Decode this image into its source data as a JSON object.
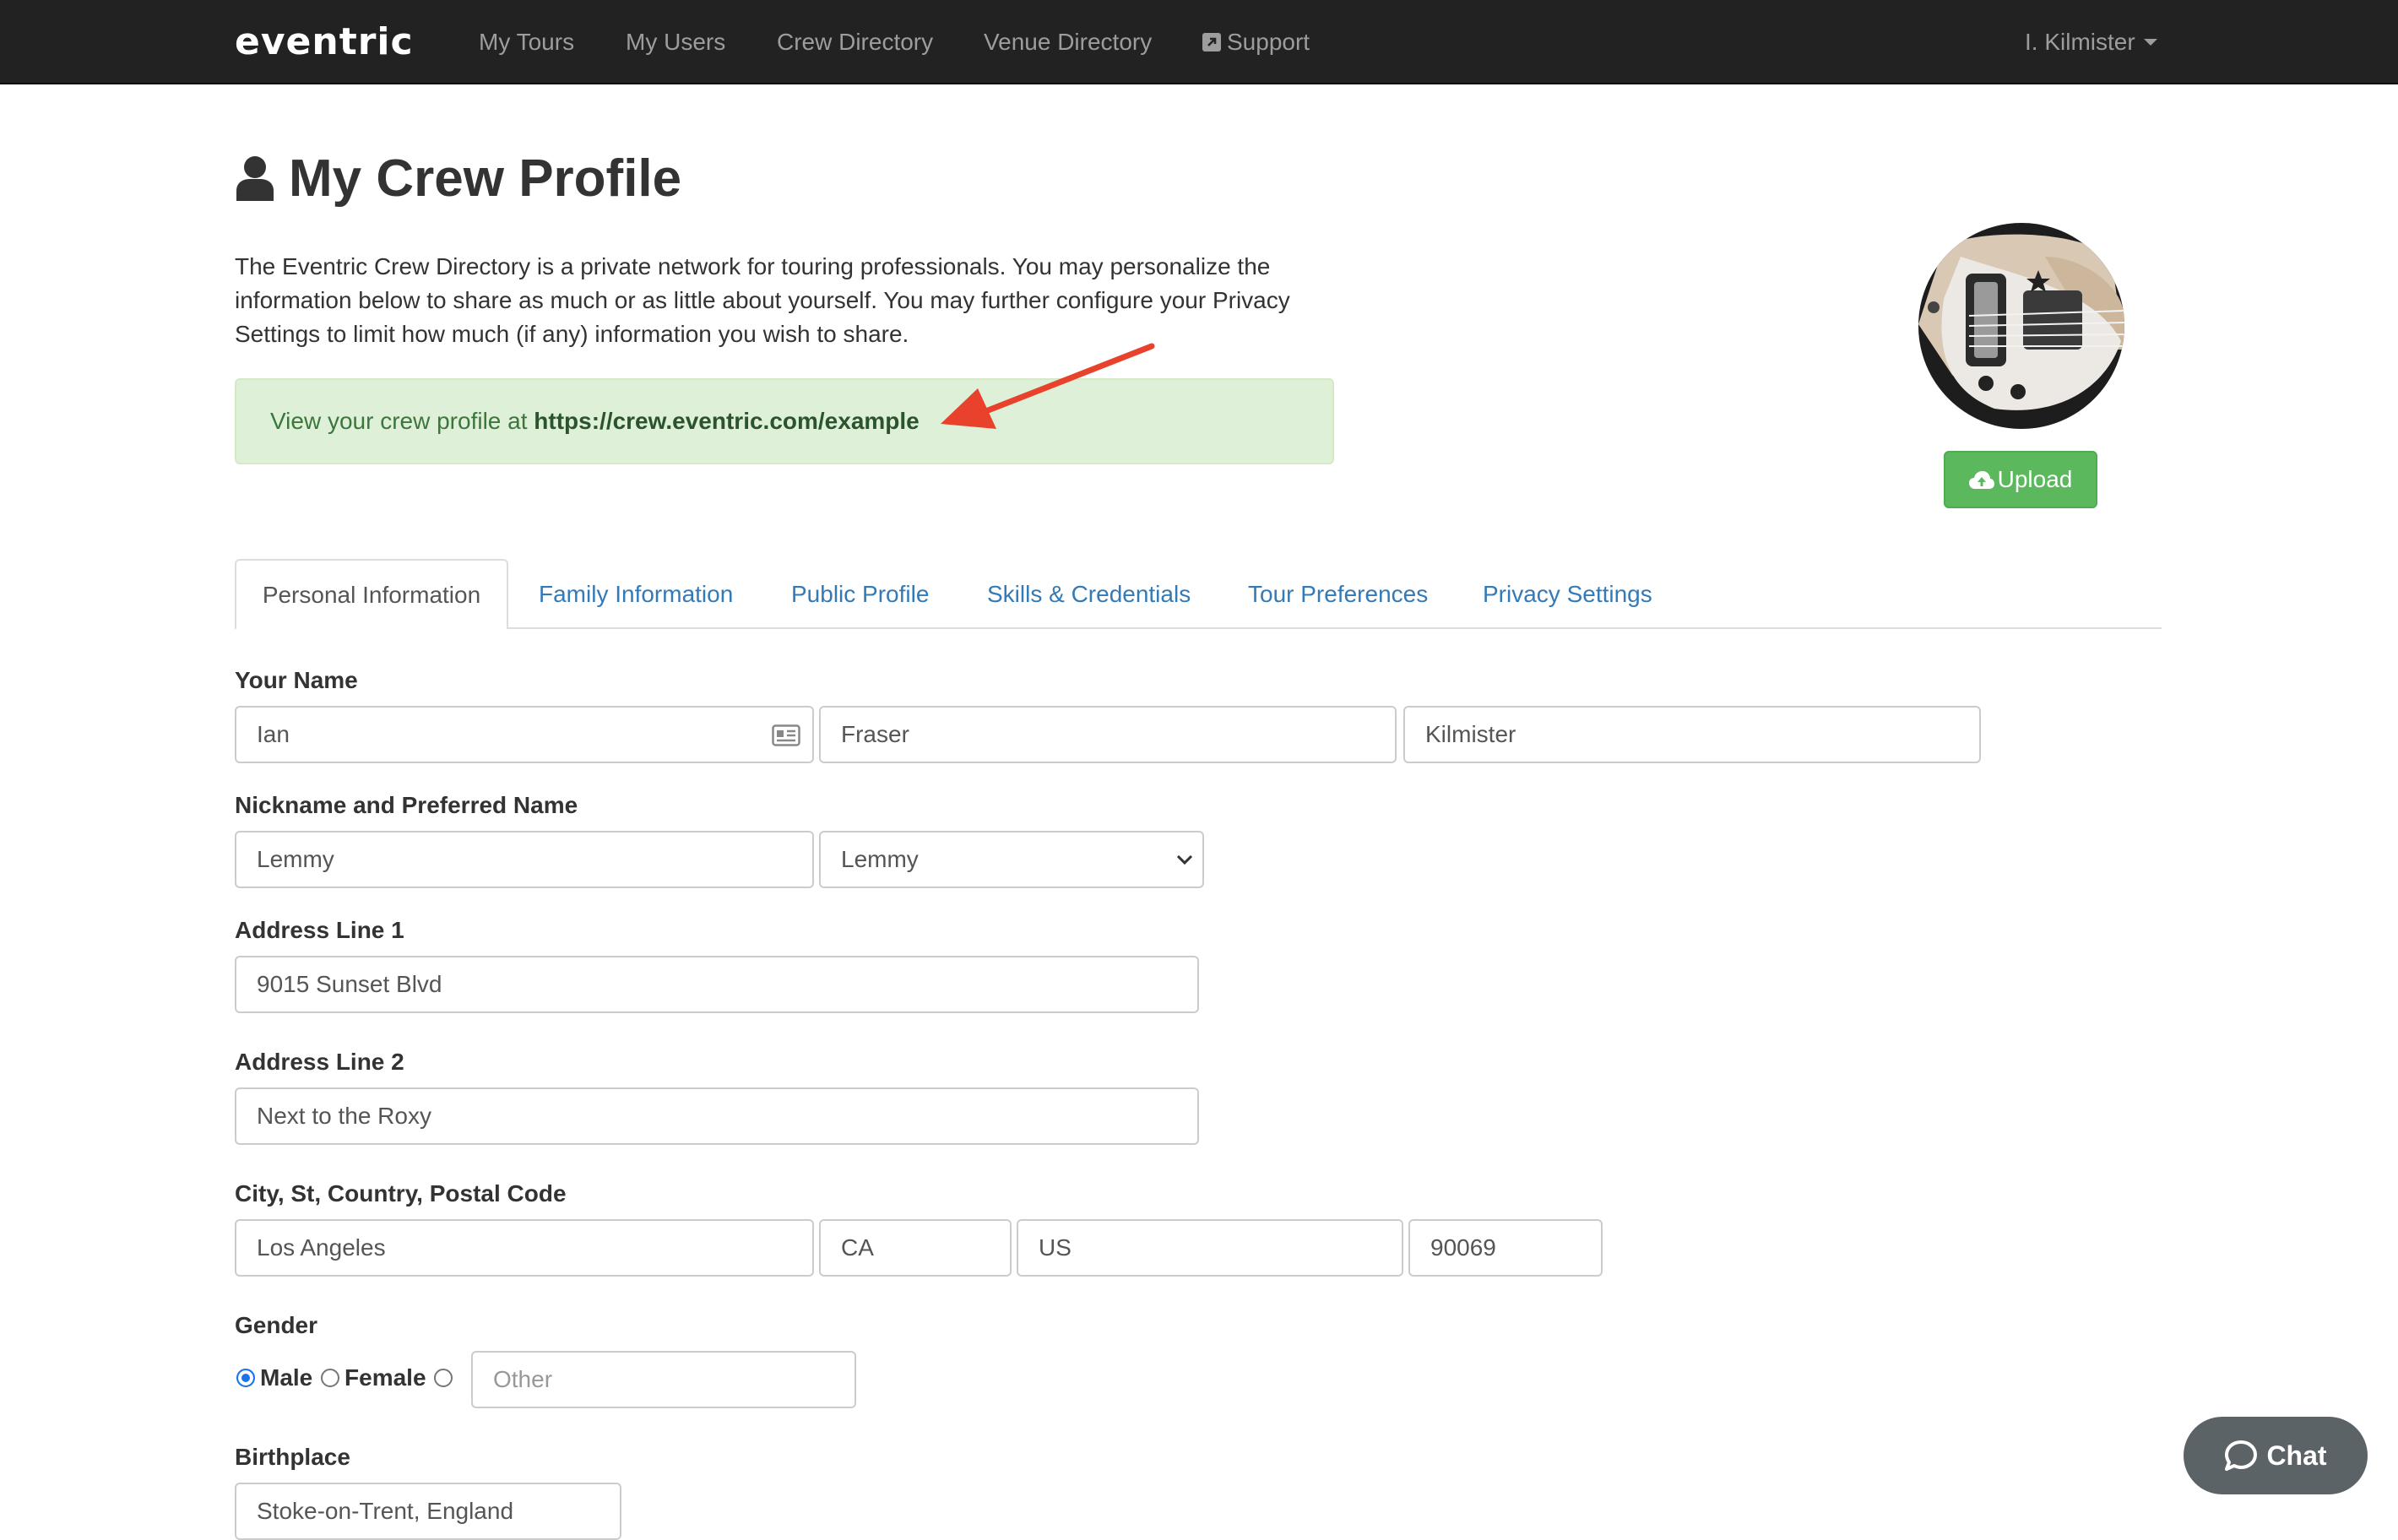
{
  "navbar": {
    "brand": "eventric",
    "links": [
      "My Tours",
      "My Users",
      "Crew Directory",
      "Venue Directory",
      "Support"
    ],
    "user_menu": "I. Kilmister",
    "icons": {
      "support": "external-link-icon",
      "user_menu": "caret-down-icon"
    }
  },
  "header": {
    "title": "My Crew Profile",
    "title_icon": "user-icon",
    "intro": "The Eventric Crew Directory is a private network for touring professionals. You may personalize the information below to share as much or as little about yourself. You may further configure your Privacy Settings to limit how much (if any) information you wish to share.",
    "alert_prefix": "View your crew profile at",
    "profile_url": "https://crew.eventric.com/example"
  },
  "avatar": {
    "image": "bass-guitar-photo",
    "upload_label": "Upload",
    "upload_icon": "cloud-upload-icon"
  },
  "tabs": [
    {
      "label": "Personal Information",
      "active": true
    },
    {
      "label": "Family Information",
      "active": false
    },
    {
      "label": "Public Profile",
      "active": false
    },
    {
      "label": "Skills & Credentials",
      "active": false
    },
    {
      "label": "Tour Preferences",
      "active": false
    },
    {
      "label": "Privacy Settings",
      "active": false
    }
  ],
  "form": {
    "name": {
      "label": "Your Name",
      "first": "Ian",
      "middle": "Fraser",
      "last": "Kilmister"
    },
    "nickname": {
      "label": "Nickname and Preferred Name",
      "nickname": "Lemmy",
      "preferred": "Lemmy"
    },
    "address1": {
      "label": "Address Line 1",
      "value": "9015 Sunset Blvd"
    },
    "address2": {
      "label": "Address Line 2",
      "value": "Next to the Roxy"
    },
    "location": {
      "label": "City, St, Country, Postal Code",
      "city": "Los Angeles",
      "state": "CA",
      "country": "US",
      "postal": "90069"
    },
    "gender": {
      "label": "Gender",
      "options": [
        "Male",
        "Female"
      ],
      "selected": "Male",
      "other_placeholder": "Other"
    },
    "birthplace": {
      "label": "Birthplace",
      "value": "Stoke-on-Trent, England"
    }
  },
  "chat": {
    "label": "Chat",
    "icon": "chat-bubble-icon"
  },
  "colors": {
    "navbar_bg": "#222222",
    "link": "#337ab7",
    "alert_bg": "#dff0d8",
    "alert_text": "#3c763d",
    "success_button": "#5cb85c",
    "annotation_arrow": "#e8412c",
    "chat_bg": "#5c6366"
  }
}
